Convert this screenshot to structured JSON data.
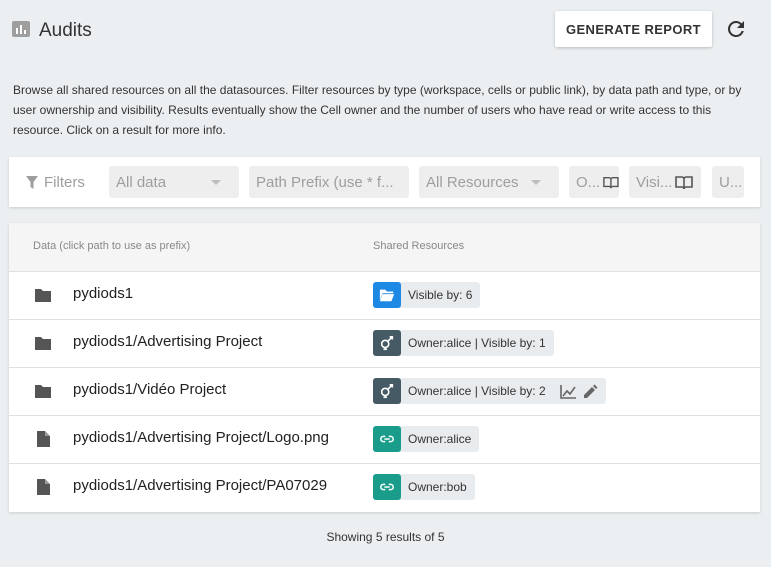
{
  "header": {
    "title": "Audits",
    "generate_button": "GENERATE REPORT",
    "title_icon": "chart-icon",
    "refresh_icon": "refresh-icon"
  },
  "description": "Browse all shared resources on all the datasources. Filter resources by type (workspace, cells or public link), by data path and type, or by user ownership and visibility. Results eventually show the Cell owner and the number of users who have read or write access to this resource. Click on a result for more info.",
  "filters": {
    "label": "Filters",
    "data_select": "All data",
    "path_prefix_placeholder": "Path Prefix (use * f...",
    "resources_select": "All Resources",
    "owner": "O...",
    "visibility": "Visi...",
    "user": "U..."
  },
  "table": {
    "col_data": "Data (click path to use as prefix)",
    "col_shared": "Shared Resources",
    "rows": [
      {
        "path": "pydiods1",
        "icon": "folder-icon",
        "chip": "Visible by: 6",
        "chip_icon": "folder-open-icon",
        "chip_color": "#1e88e5"
      },
      {
        "path": "pydiods1/Advertising Project",
        "icon": "folder-icon",
        "chip": "Owner:alice | Visible by: 1",
        "chip_icon": "cells-icon",
        "chip_color": "#455a64"
      },
      {
        "path": "pydiods1/Vidéo Project",
        "icon": "folder-icon",
        "chip": "Owner:alice | Visible by: 2",
        "chip_icon": "cells-icon",
        "chip_color": "#455a64"
      },
      {
        "path": "pydiods1/Advertising Project/Logo.png",
        "icon": "file-icon",
        "chip": "Owner:alice",
        "chip_icon": "link-icon",
        "chip_color": "#1a9c8a"
      },
      {
        "path": "pydiods1/Advertising Project/PA07029",
        "icon": "file-icon",
        "chip": "Owner:bob",
        "chip_icon": "link-icon",
        "chip_color": "#1a9c8a"
      }
    ]
  },
  "footer": "Showing 5 results of 5"
}
